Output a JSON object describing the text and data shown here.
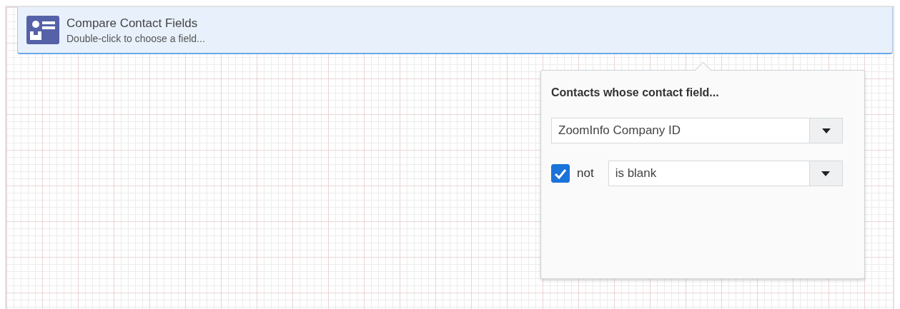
{
  "step": {
    "title": "Compare Contact Fields",
    "subtitle": "Double-click to choose a field..."
  },
  "popover": {
    "heading": "Contacts whose contact field...",
    "field_select": {
      "value": "ZoomInfo Company ID"
    },
    "negate": {
      "label": "not",
      "checked": true
    },
    "operator_select": {
      "value": "is blank"
    }
  }
}
